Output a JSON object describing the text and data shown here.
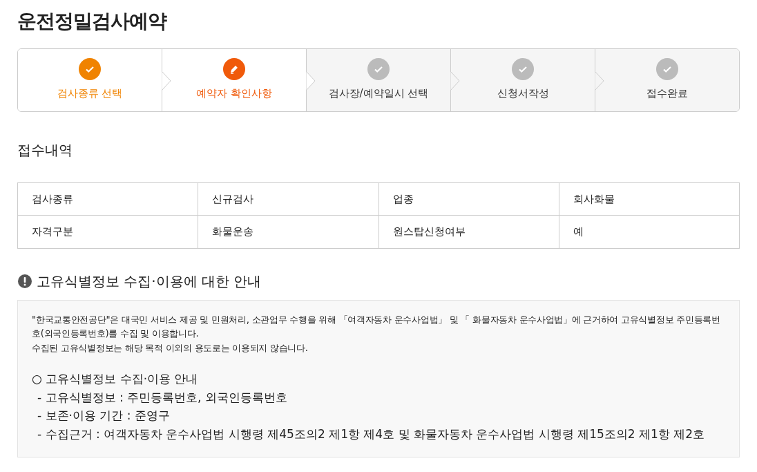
{
  "page_title": "운전정밀검사예약",
  "steps": [
    {
      "label": "검사종류 선택",
      "completed": true,
      "current": false
    },
    {
      "label": "예약자 확인사항",
      "completed": false,
      "current": true
    },
    {
      "label": "검사장/예약일시 선택",
      "completed": false,
      "current": false
    },
    {
      "label": "신청서작성",
      "completed": false,
      "current": false
    },
    {
      "label": "접수완료",
      "completed": false,
      "current": false
    }
  ],
  "receipt": {
    "title": "접수내역",
    "rows": [
      {
        "cells": [
          "검사종류",
          "신규검사",
          "업종",
          "회사화물"
        ]
      },
      {
        "cells": [
          "자격구분",
          "화물운송",
          "원스탑신청여부",
          "예"
        ]
      }
    ]
  },
  "notice": {
    "title": "고유식별정보 수집·이용에 대한 안내",
    "paragraphs": [
      "\"한국교통안전공단\"은 대국민 서비스 제공 및 민원처리, 소관업무 수행을 위해 「여객자동차 운수사업법」 및 「 화물자동차 운수사업법」에 근거하여 고유식별정보 주민등록번호(외국인등록번호)를 수집 및 이용합니다.",
      "수집된 고유식별정보는 해당 목적 이외의 용도로는 이용되지 않습니다."
    ],
    "list_title": "○ 고유식별정보 수집·이용 안내",
    "items": [
      "- 고유식별정보 : 주민등록번호, 외국인등록번호",
      "- 보존·이용 기간 : 준영구",
      "- 수집근거 : 여객자동차 운수사업법 시행령 제45조의2 제1항 제4호 및 화물자동차 운수사업법 시행령 제15조의2 제1항 제2호"
    ]
  }
}
